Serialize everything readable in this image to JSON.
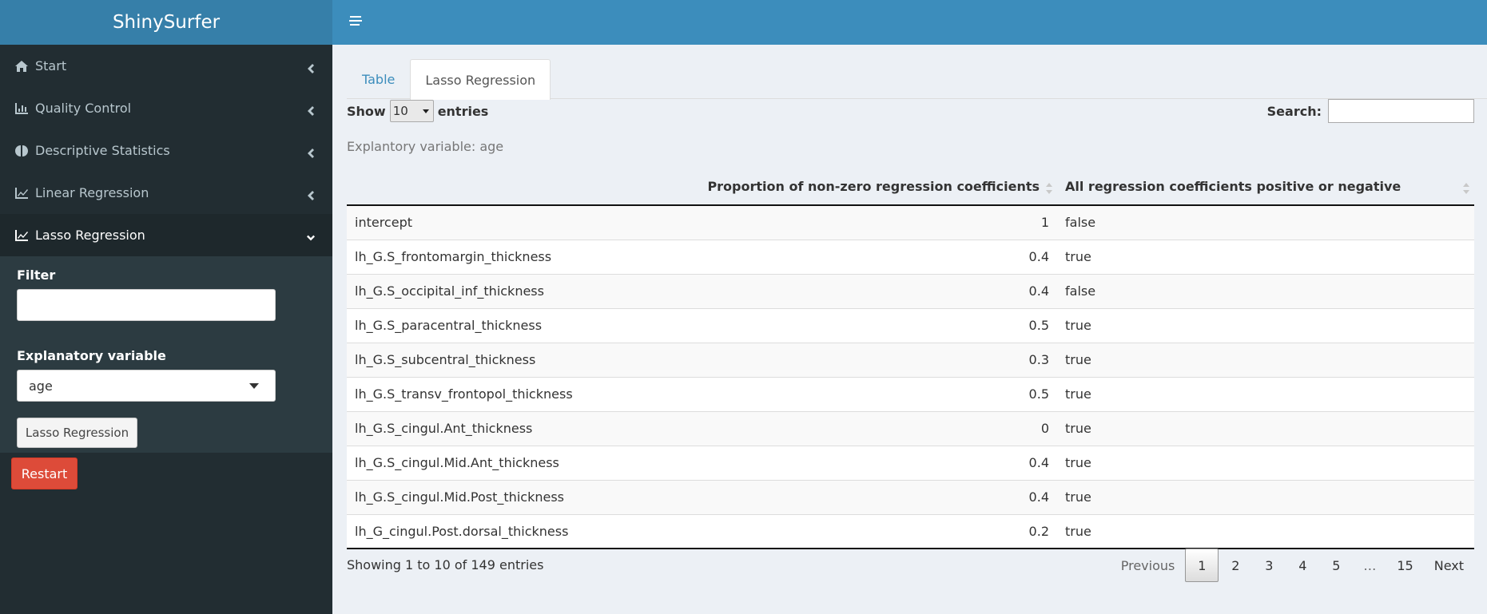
{
  "app": {
    "title": "ShinySurfer"
  },
  "sidebar": {
    "items": [
      {
        "label": "Start",
        "icon": "home-icon"
      },
      {
        "label": "Quality Control",
        "icon": "bar-chart-icon"
      },
      {
        "label": "Descriptive Statistics",
        "icon": "brain-icon"
      },
      {
        "label": "Linear Regression",
        "icon": "line-chart-icon"
      },
      {
        "label": "Lasso Regression",
        "icon": "line-chart-icon"
      }
    ],
    "filter_label": "Filter",
    "filter_value": "",
    "explanatory_label": "Explanatory variable",
    "explanatory_value": "age",
    "lasso_button": "Lasso Regression",
    "restart_button": "Restart"
  },
  "tabs": [
    {
      "label": "Table",
      "active": false
    },
    {
      "label": "Lasso Regression",
      "active": true
    }
  ],
  "table_controls": {
    "show_label": "Show",
    "entries_value": "10",
    "entries_label": "entries",
    "search_label": "Search:",
    "search_value": ""
  },
  "caption": "Explantory variable: age",
  "table": {
    "columns": [
      "",
      "Proportion of non-zero regression coefficients",
      "All regression coefficients positive or negative"
    ],
    "rows": [
      [
        "intercept",
        "1",
        "false"
      ],
      [
        "lh_G.S_frontomargin_thickness",
        "0.4",
        "true"
      ],
      [
        "lh_G.S_occipital_inf_thickness",
        "0.4",
        "false"
      ],
      [
        "lh_G.S_paracentral_thickness",
        "0.5",
        "true"
      ],
      [
        "lh_G.S_subcentral_thickness",
        "0.3",
        "true"
      ],
      [
        "lh_G.S_transv_frontopol_thickness",
        "0.5",
        "true"
      ],
      [
        "lh_G.S_cingul.Ant_thickness",
        "0",
        "true"
      ],
      [
        "lh_G.S_cingul.Mid.Ant_thickness",
        "0.4",
        "true"
      ],
      [
        "lh_G.S_cingul.Mid.Post_thickness",
        "0.4",
        "true"
      ],
      [
        "lh_G_cingul.Post.dorsal_thickness",
        "0.2",
        "true"
      ]
    ]
  },
  "footer": {
    "info": "Showing 1 to 10 of 149 entries",
    "pagination": {
      "previous": "Previous",
      "pages": [
        "1",
        "2",
        "3",
        "4",
        "5",
        "…",
        "15"
      ],
      "current": "1",
      "next": "Next"
    }
  }
}
